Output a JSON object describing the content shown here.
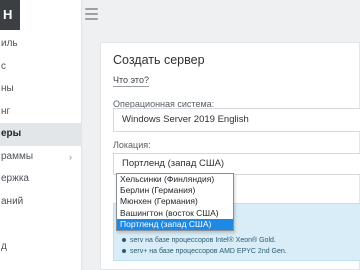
{
  "sidebar": {
    "logo_text": "H",
    "items": [
      {
        "label": "иль",
        "active": false
      },
      {
        "label": "с",
        "active": false
      },
      {
        "label": "ны",
        "active": false
      },
      {
        "label": "нг",
        "active": false
      },
      {
        "label": "еры",
        "active": true
      },
      {
        "label": "раммы",
        "active": false,
        "has_submenu": true
      },
      {
        "label": "ержка",
        "active": false
      },
      {
        "label": "аний",
        "active": false
      },
      {
        "label": "",
        "active": false
      },
      {
        "label": "д",
        "active": false
      }
    ]
  },
  "card": {
    "title": "Создать сервер",
    "what_link": "Что это?",
    "os_label": "Операционная система:",
    "os_value": "Windows Server 2019 English",
    "location_label": "Локация:",
    "location_value": "Портленд (запад США)"
  },
  "dropdown": {
    "options": [
      {
        "label": "Хельсинки (Финляндия)",
        "selected": false
      },
      {
        "label": "Берлин (Германия)",
        "selected": false
      },
      {
        "label": "Мюнхен (Германия)",
        "selected": false
      },
      {
        "label": "Вашингтон (восток США)",
        "selected": false
      },
      {
        "label": "Портленд (запад США)",
        "selected": true
      }
    ]
  },
  "info": {
    "items": [
      "serv на базе процессоров Intel® Xeon® Gold.",
      "serv+ на базе процессоров AMD EPYC 2nd Gen."
    ]
  },
  "colors": {
    "accent": "#1e88e5",
    "sidebar_active_bg": "#e3e6e9",
    "info_bg": "#d8edf7"
  }
}
